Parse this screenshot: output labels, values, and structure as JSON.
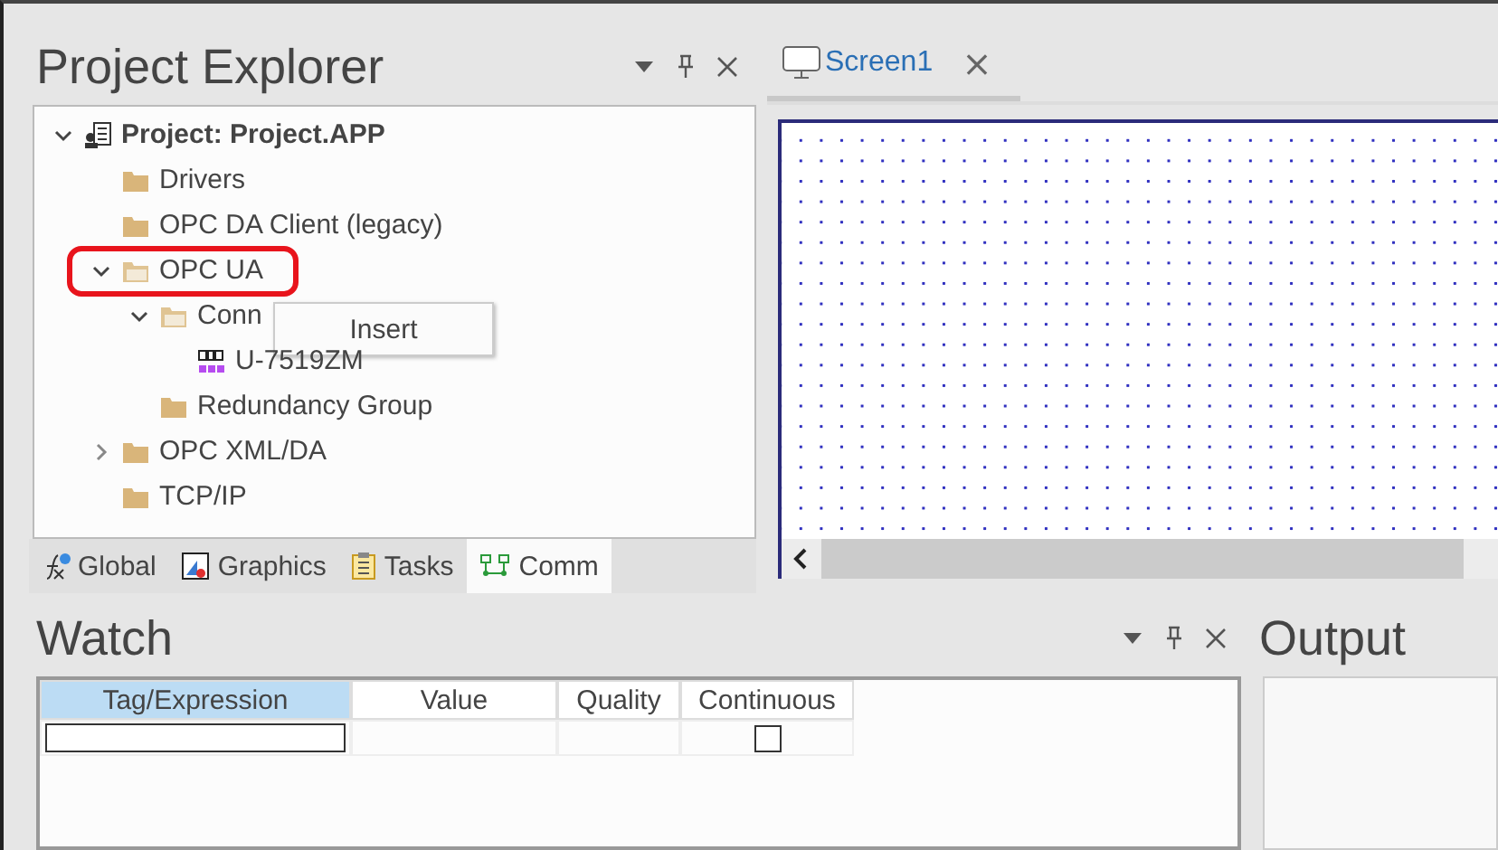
{
  "project_explorer": {
    "title": "Project Explorer",
    "tree": [
      {
        "label": "Project: Project.APP",
        "kind": "project",
        "expanded": true,
        "children": [
          {
            "label": "Drivers",
            "kind": "folder"
          },
          {
            "label": "OPC DA Client (legacy)",
            "kind": "folder"
          },
          {
            "label": "OPC UA",
            "kind": "open-folder",
            "expanded": true,
            "children": [
              {
                "label": "Conn",
                "kind": "open-folder",
                "expanded": true,
                "children": [
                  {
                    "label": "U-7519ZM",
                    "kind": "device"
                  }
                ]
              },
              {
                "label": "Redundancy Group",
                "kind": "folder"
              }
            ]
          },
          {
            "label": "OPC XML/DA",
            "kind": "folder",
            "expanded": false
          },
          {
            "label": "TCP/IP",
            "kind": "folder"
          }
        ]
      }
    ],
    "context_menu": {
      "items": [
        "Insert"
      ]
    },
    "tabs": [
      {
        "label": "Global",
        "kind": "global",
        "selected": false
      },
      {
        "label": "Graphics",
        "kind": "graphics",
        "selected": false
      },
      {
        "label": "Tasks",
        "kind": "tasks",
        "selected": false
      },
      {
        "label": "Comm",
        "kind": "comm",
        "selected": true
      }
    ]
  },
  "editor": {
    "tabs": [
      {
        "label": "Screen1",
        "close": "×",
        "selected": true
      }
    ]
  },
  "watch": {
    "title": "Watch",
    "columns": [
      {
        "label": "Tag/Expression",
        "selected": true
      },
      {
        "label": "Value",
        "selected": false
      },
      {
        "label": "Quality",
        "selected": false
      },
      {
        "label": "Continuous",
        "selected": false
      }
    ],
    "rows": [
      {
        "continuous": false
      }
    ]
  },
  "output": {
    "title": "Output"
  }
}
